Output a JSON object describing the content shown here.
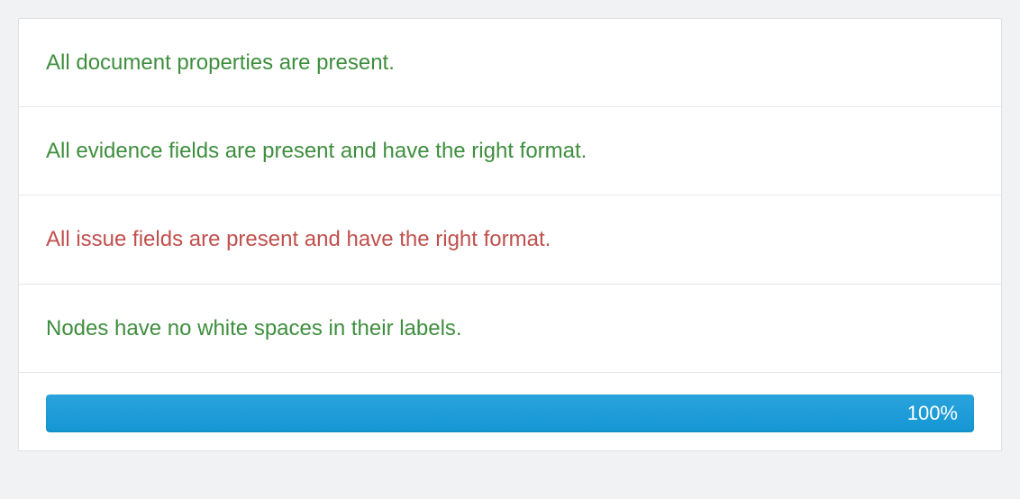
{
  "validation": {
    "items": [
      {
        "text": "All document properties are present.",
        "status": "success"
      },
      {
        "text": "All evidence fields are present and have the right format.",
        "status": "success"
      },
      {
        "text": "All issue fields are present and have the right format.",
        "status": "error"
      },
      {
        "text": "Nodes have no white spaces in their labels.",
        "status": "success"
      }
    ]
  },
  "progress": {
    "percent": 100,
    "label": "100%",
    "color": "#1a9cd8"
  }
}
